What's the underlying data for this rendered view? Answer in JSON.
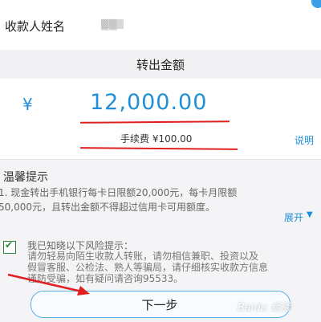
{
  "recipient": {
    "label": "收款人姓名",
    "value": "▒▒"
  },
  "amount": {
    "header": "转出金额",
    "currency_symbol": "¥",
    "value": "12,000.00",
    "fee": "手续费 ¥100.00",
    "explain_link": "说明"
  },
  "tips": {
    "title": "温馨提示",
    "line_1": "1. 现金转出手机银行每卡日限额20,000元，每卡月限额",
    "line_2": "50,000元，且转出金额不得超过信用卡可用额度。",
    "expand_label": "展开",
    "expand_icon": "chevron-down-icon"
  },
  "risk": {
    "checked": true,
    "title": "我已知晓以下风险提示：",
    "line_1": "请勿轻易向陌生收款人转账，请勿相信兼职、投资以及",
    "line_2": "假冒客服、公检法、熟人等骗局，请仔细核实收款方信息",
    "line_3": "谨防受骗，如有疑问请咨询95533。"
  },
  "next_button": {
    "label": "下一步"
  },
  "watermark": "Baidu 经验",
  "colors": {
    "accent_blue": "#1e8fd8",
    "annotation_red": "#e02020",
    "check_green": "#2a8a3a"
  }
}
